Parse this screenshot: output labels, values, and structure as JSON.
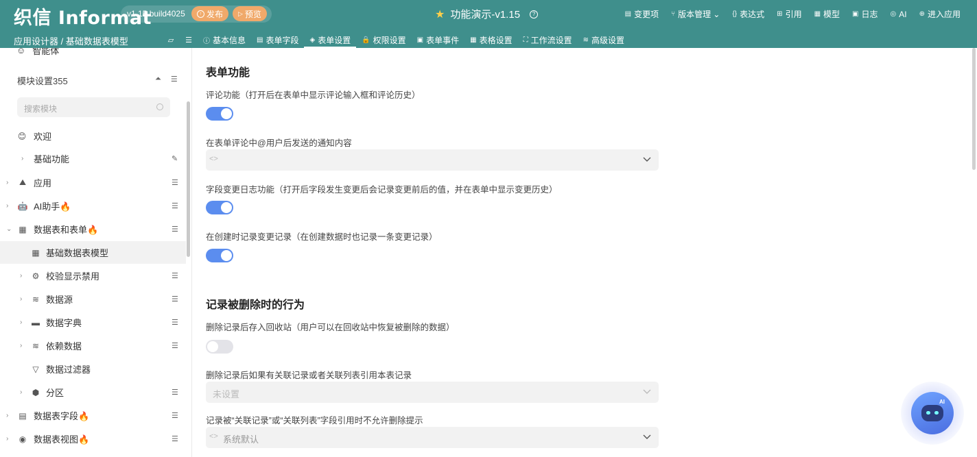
{
  "header": {
    "logo": "织信 Informat",
    "version": "v1.15 build4025",
    "publish_label": "发布",
    "preview_label": "预览",
    "title": "功能演示-v1.15",
    "nav": [
      {
        "icon": "list-icon",
        "glyph": "▤",
        "label": "变更项"
      },
      {
        "icon": "branch-icon",
        "glyph": "⑂",
        "label": "版本管理 ⌄"
      },
      {
        "icon": "braces-icon",
        "glyph": "{}",
        "label": "表达式"
      },
      {
        "icon": "link-icon",
        "glyph": "⊞",
        "label": "引用"
      },
      {
        "icon": "grid-icon",
        "glyph": "▦",
        "label": "模型"
      },
      {
        "icon": "log-icon",
        "glyph": "▣",
        "label": "日志"
      },
      {
        "icon": "ai-icon",
        "glyph": "◎",
        "label": "AI"
      },
      {
        "icon": "enter-icon",
        "glyph": "⊕",
        "label": "进入应用"
      }
    ],
    "breadcrumb": "应用设计器 / 基础数据表模型",
    "tabs": [
      {
        "glyph": "ⓘ",
        "label": "基本信息"
      },
      {
        "glyph": "▤",
        "label": "表单字段"
      },
      {
        "glyph": "◈",
        "label": "表单设置"
      },
      {
        "glyph": "🔒",
        "label": "权限设置"
      },
      {
        "glyph": "▣",
        "label": "表单事件"
      },
      {
        "glyph": "▦",
        "label": "表格设置"
      },
      {
        "glyph": "⛶",
        "label": "工作流设置"
      },
      {
        "glyph": "≋",
        "label": "高级设置"
      }
    ]
  },
  "sidebar": {
    "top_item": "智能体",
    "module_title": "模块设置355",
    "search_placeholder": "搜索模块",
    "items": [
      {
        "label": "欢迎",
        "icon": "😊"
      },
      {
        "label": "基础功能",
        "icon": ""
      },
      {
        "label": "应用",
        "icon": "⛰"
      },
      {
        "label": "AI助手🔥",
        "icon": "🤖"
      },
      {
        "label": "数据表和表单🔥",
        "icon": "▦"
      },
      {
        "label": "基础数据表模型",
        "icon": "▦"
      },
      {
        "label": "校验显示禁用",
        "icon": "⚙"
      },
      {
        "label": "数据源",
        "icon": "≋"
      },
      {
        "label": "数据字典",
        "icon": "▬"
      },
      {
        "label": "依赖数据",
        "icon": "≋"
      },
      {
        "label": "数据过滤器",
        "icon": "▽"
      },
      {
        "label": "分区",
        "icon": "⬢"
      },
      {
        "label": "数据表字段🔥",
        "icon": "▤"
      },
      {
        "label": "数据表视图🔥",
        "icon": "◉"
      }
    ]
  },
  "main": {
    "section1_title": "表单功能",
    "comment_label": "评论功能（打开后在表单中显示评论输入框和评论历史）",
    "comment_enabled": true,
    "mention_label": "在表单评论中@用户后发送的通知内容",
    "changelog_label": "字段变更日志功能（打开后字段发生变更后会记录变更前后的值，并在表单中显示变更历史）",
    "changelog_enabled": true,
    "create_record_label": "在创建时记录变更记录（在创建数据时也记录一条变更记录）",
    "create_record_enabled": true,
    "section2_title": "记录被删除时的行为",
    "recycle_label": "删除记录后存入回收站（用户可以在回收站中恢复被删除的数据）",
    "recycle_enabled": false,
    "related_label": "删除记录后如果有关联记录或者关联列表引用本表记录",
    "related_value": "未设置",
    "prompt_label": "记录被“关联记录”或“关联列表”字段引用时不允许删除提示",
    "prompt_value": "系统默认"
  },
  "colors": {
    "header": "#3f8f8c",
    "toggle_on": "#5b8def",
    "pill": "#f0a96a"
  }
}
